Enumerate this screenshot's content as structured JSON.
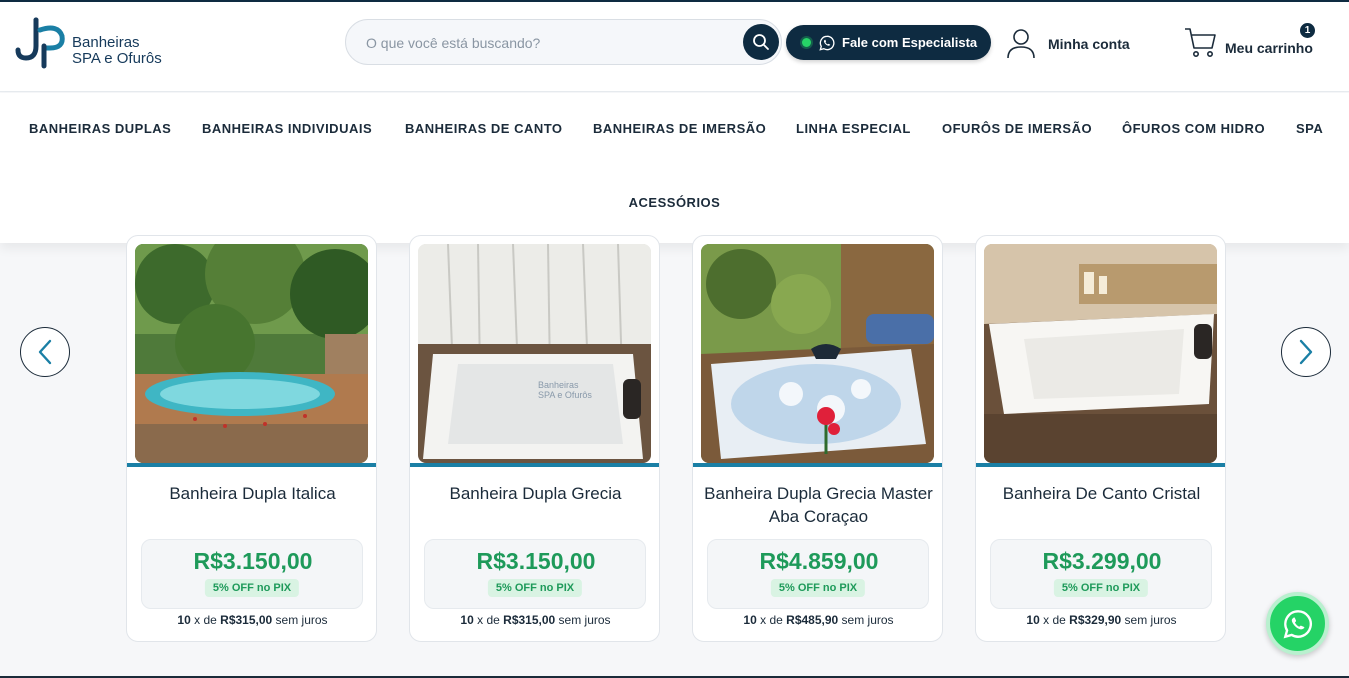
{
  "header": {
    "logo_line1": "Banheiras",
    "logo_line2": "SPA e Ofurôs",
    "search_placeholder": "O que você está buscando?",
    "specialist_label": "Fale com Especialista",
    "account_label": "Minha conta",
    "cart_label": "Meu carrinho",
    "cart_count": "1"
  },
  "nav": {
    "items": [
      "BANHEIRAS DUPLAS",
      "BANHEIRAS INDIVIDUAIS",
      "BANHEIRAS DE CANTO",
      "BANHEIRAS DE IMERSÃO",
      "LINHA ESPECIAL",
      "OFURÔS DE IMERSÃO",
      "ÔFUROS COM HIDRO",
      "SPA",
      "ACESSÓRIOS"
    ]
  },
  "products": [
    {
      "name": "Banheira Dupla Italica",
      "price": "R$3.150,00",
      "pix": "5% OFF no PIX",
      "inst_n": "10",
      "inst_of": "x de",
      "inst_value": "R$315,00",
      "inst_suffix": "sem juros"
    },
    {
      "name": "Banheira Dupla Grecia",
      "price": "R$3.150,00",
      "pix": "5% OFF no PIX",
      "inst_n": "10",
      "inst_of": "x de",
      "inst_value": "R$315,00",
      "inst_suffix": "sem juros"
    },
    {
      "name": "Banheira Dupla Grecia Master Aba Coraçao",
      "price": "R$4.859,00",
      "pix": "5% OFF no PIX",
      "inst_n": "10",
      "inst_of": "x de",
      "inst_value": "R$485,90",
      "inst_suffix": "sem juros"
    },
    {
      "name": "Banheira De Canto Cristal",
      "price": "R$3.299,00",
      "pix": "5% OFF no PIX",
      "inst_n": "10",
      "inst_of": "x de",
      "inst_value": "R$329,90",
      "inst_suffix": "sem juros"
    }
  ],
  "watermark": {
    "line1": "Banheiras",
    "line2": "SPA e Ofurôs"
  },
  "icons": {
    "search": "search-icon",
    "whatsapp": "whatsapp-icon",
    "user": "user-icon",
    "cart": "cart-icon",
    "arrow_left": "chevron-left-icon",
    "arrow_right": "chevron-right-icon"
  },
  "colors": {
    "brand_dark": "#0e2b41",
    "price_green": "#1e9a5a",
    "accent_blue": "#1a7fa5",
    "whatsapp": "#25d366"
  }
}
